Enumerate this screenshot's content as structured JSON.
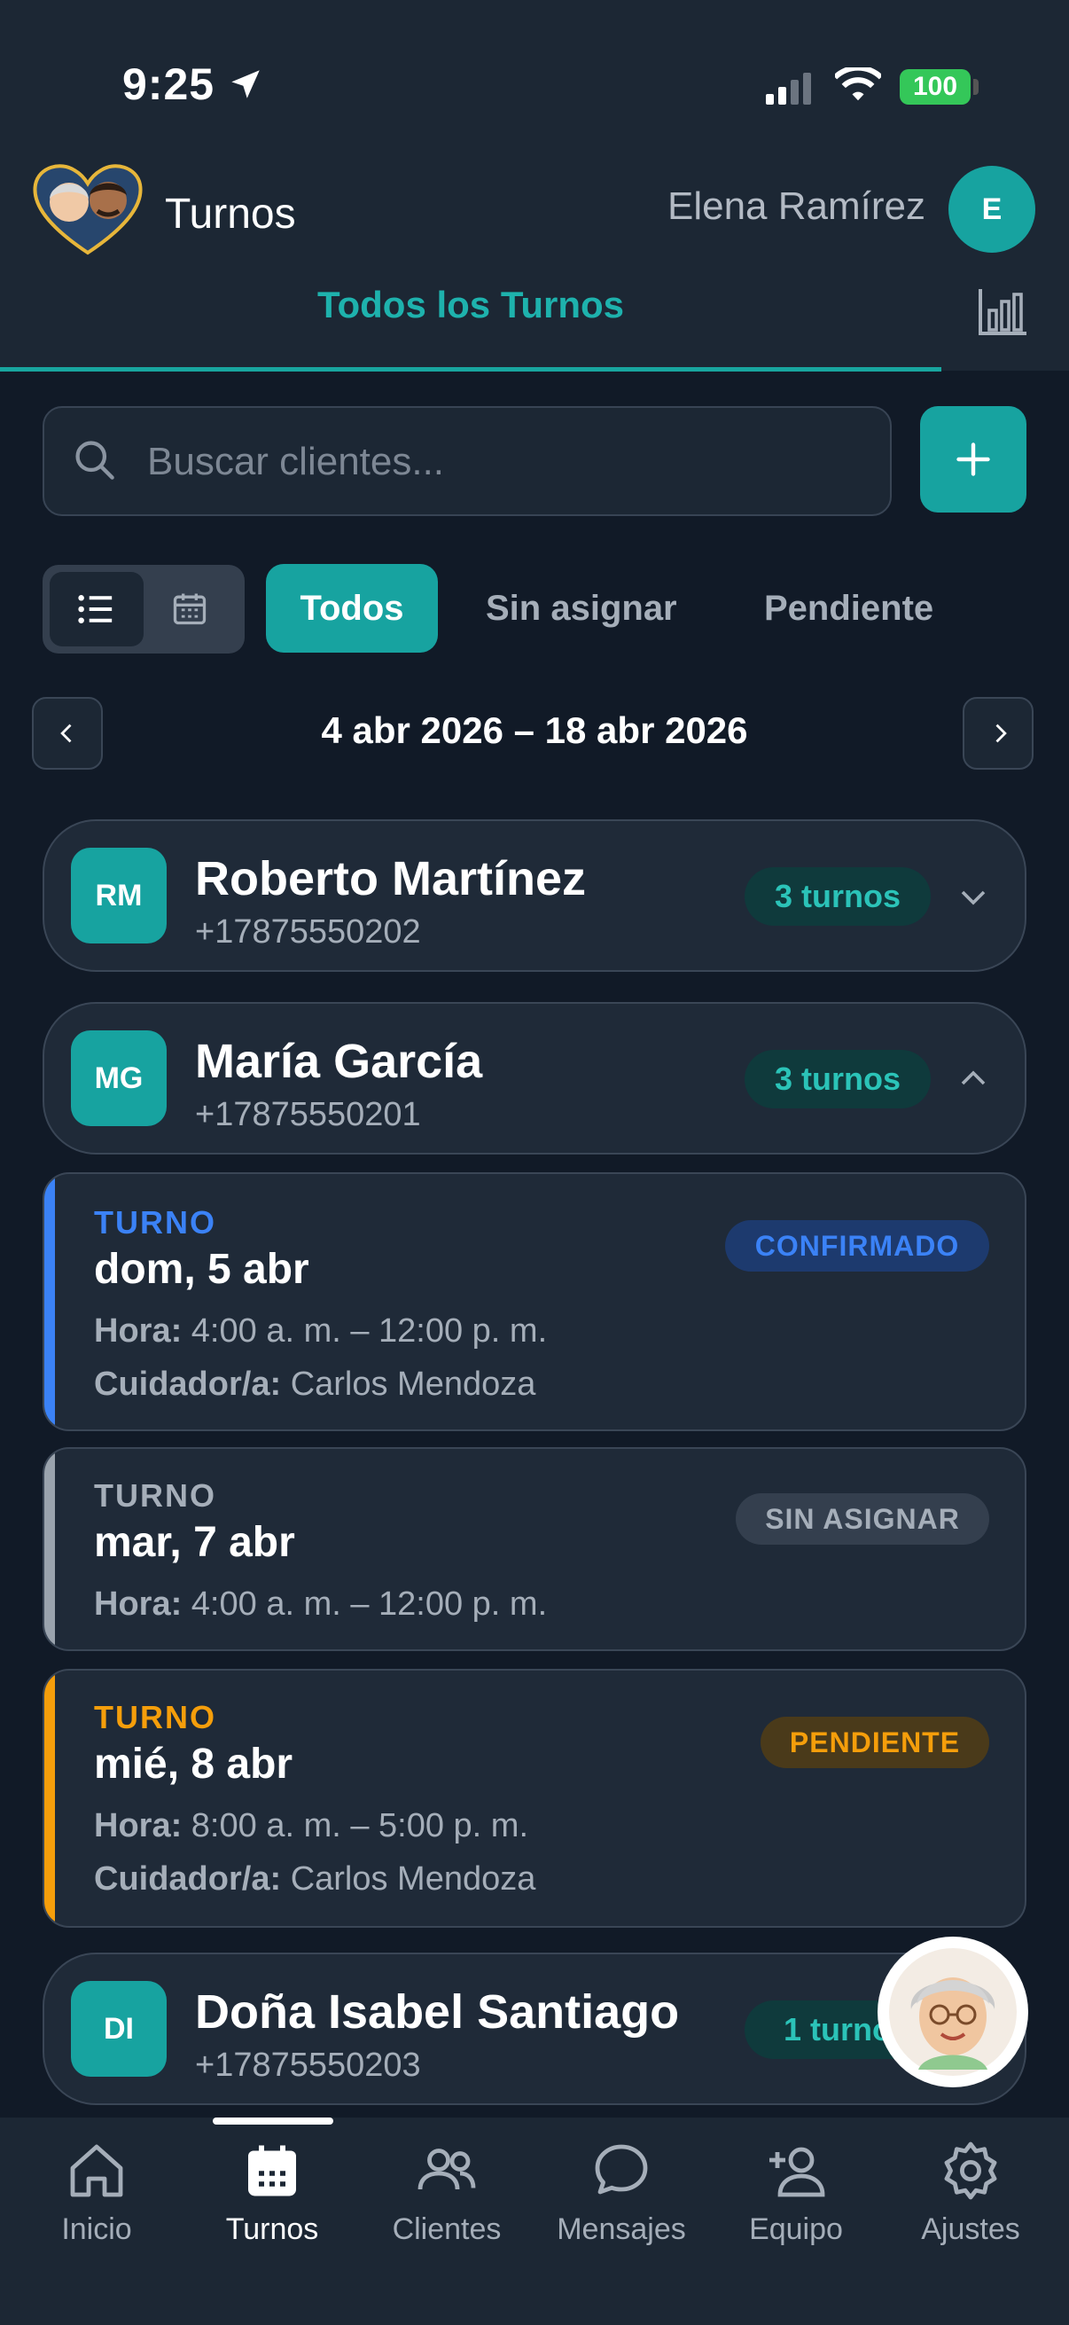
{
  "status_bar": {
    "time": "9:25",
    "battery": "100"
  },
  "header": {
    "title": "Turnos",
    "user_name": "Elena Ramírez",
    "user_initial": "E"
  },
  "tabs": {
    "active": "Todos los Turnos"
  },
  "search": {
    "placeholder": "Buscar clientes..."
  },
  "filters": [
    "Todos",
    "Sin asignar",
    "Pendiente"
  ],
  "date_range": "4 abr 2026 – 18 abr 2026",
  "clients": [
    {
      "initials": "RM",
      "name": "Roberto Martínez",
      "phone": "+17875550202",
      "count": "3 turnos"
    },
    {
      "initials": "MG",
      "name": "María García",
      "phone": "+17875550201",
      "count": "3 turnos"
    },
    {
      "initials": "DI",
      "name": "Doña Isabel Santiago",
      "phone": "+17875550203",
      "count": "1 turno"
    }
  ],
  "shifts": [
    {
      "label": "TURNO",
      "date": "dom, 5 abr",
      "hora_label": "Hora:",
      "hora": "4:00 a. m. – 12:00 p. m.",
      "cuidador_label": "Cuidador/a:",
      "cuidador": "Carlos Mendoza",
      "status": "CONFIRMADO"
    },
    {
      "label": "TURNO",
      "date": "mar, 7 abr",
      "hora_label": "Hora:",
      "hora": "4:00 a. m. – 12:00 p. m.",
      "status": "SIN ASIGNAR"
    },
    {
      "label": "TURNO",
      "date": "mié, 8 abr",
      "hora_label": "Hora:",
      "hora": "8:00 a. m. – 5:00 p. m.",
      "cuidador_label": "Cuidador/a:",
      "cuidador": "Carlos Mendoza",
      "status": "PENDIENTE"
    }
  ],
  "colors": {
    "accent": "#17a3a0",
    "confirmed": "#3b82f6",
    "pending": "#f59e0b",
    "unassigned": "#9aa3ad"
  },
  "bottom_nav": [
    {
      "label": "Inicio",
      "icon": "home-icon"
    },
    {
      "label": "Turnos",
      "icon": "calendar-icon"
    },
    {
      "label": "Clientes",
      "icon": "users-icon"
    },
    {
      "label": "Mensajes",
      "icon": "message-icon"
    },
    {
      "label": "Equipo",
      "icon": "add-user-icon"
    },
    {
      "label": "Ajustes",
      "icon": "gear-icon"
    }
  ]
}
